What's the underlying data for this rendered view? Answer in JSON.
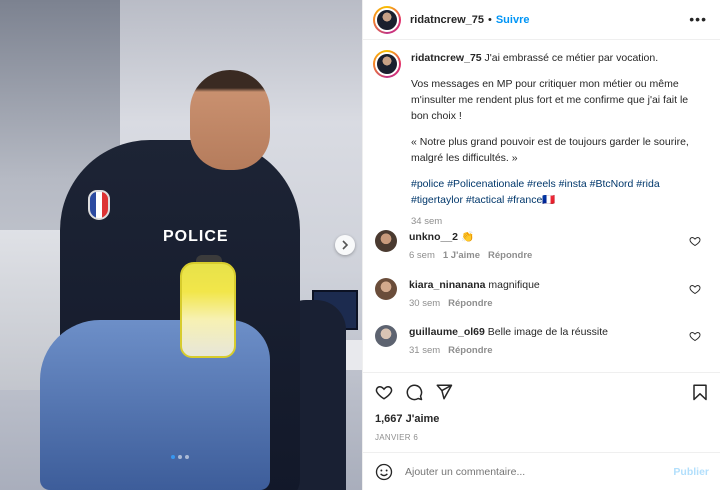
{
  "post": {
    "username": "ridatncrew_75",
    "follow_label": "Suivre",
    "separator": "•",
    "more_label": "•••",
    "caption": {
      "line1": "J'ai embrassé ce métier par vocation.",
      "line2": "Vos messages en MP pour critiquer mon métier ou même m'insulter me rendent plus fort et me confirme que j'ai fait le bon choix !",
      "line3": "« Notre plus grand pouvoir est de toujours garder le sourire, malgré les difficultés. »",
      "hashtags": "#police #Policenationale #reels #insta #BtcNord #rida #tigertaylor #tactical #france🇫🇷",
      "age": "34 sem"
    },
    "image_text": "POLICE",
    "carousel": {
      "next_icon": "chevron-right-icon",
      "current": 1,
      "total": 3
    }
  },
  "comments": [
    {
      "user": "unkno__2",
      "text": "👏",
      "age": "6 sem",
      "likes": "1 J'aime",
      "reply": "Répondre",
      "avatar_color": "#5a4537"
    },
    {
      "user": "kiara_ninanana",
      "text": "magnifique",
      "age": "30 sem",
      "likes": "",
      "reply": "Répondre",
      "avatar_color": "#8a6a52"
    },
    {
      "user": "guillaume_ol69",
      "text": "Belle image de la réussite",
      "age": "31 sem",
      "likes": "",
      "reply": "Répondre",
      "avatar_color": "#7a7f88"
    }
  ],
  "actions": {
    "like_icon": "heart-icon",
    "comment_icon": "comment-icon",
    "share_icon": "paper-plane-icon",
    "save_icon": "bookmark-icon",
    "likes_count": "1,667",
    "likes_label": "J'aime",
    "date": "JANVIER 6"
  },
  "comment_box": {
    "emoji_icon": "smiley-icon",
    "placeholder": "Ajouter un commentaire...",
    "publish_label": "Publier"
  },
  "colors": {
    "link": "#0095f6",
    "hashtag": "#00376b",
    "muted": "#8e8e8e",
    "publish_disabled": "#b2dffc",
    "carousel_active": "#3897f0"
  }
}
